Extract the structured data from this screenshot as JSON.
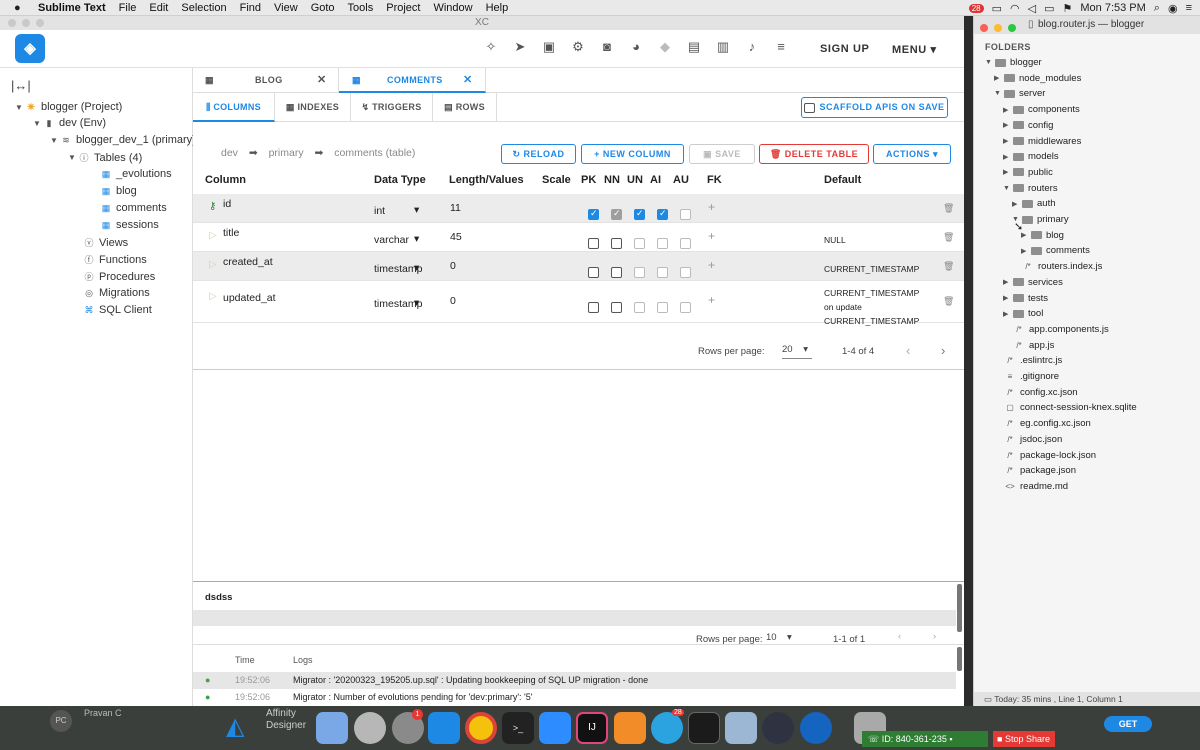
{
  "menubar": {
    "app": "Sublime Text",
    "items": [
      "File",
      "Edit",
      "Selection",
      "Find",
      "View",
      "Goto",
      "Tools",
      "Project",
      "Window",
      "Help"
    ],
    "badge": "28",
    "clock": "Mon 7:53 PM"
  },
  "xc": {
    "window_title": "XC",
    "signup": "SIGN UP",
    "menu": "MENU"
  },
  "sidebar": {
    "project": "blogger (Project)",
    "env": "dev (Env)",
    "db": "blogger_dev_1 (primary)",
    "tables_label": "Tables (4)",
    "tables": [
      "_evolutions",
      "blog",
      "comments",
      "sessions"
    ],
    "items": [
      "Views",
      "Functions",
      "Procedures",
      "Migrations",
      "SQL Client"
    ]
  },
  "tabs": [
    {
      "label": "BLOG"
    },
    {
      "label": "COMMENTS"
    }
  ],
  "subtabs": [
    "COLUMNS",
    "INDEXES",
    "TRIGGERS",
    "ROWS"
  ],
  "scaffold": "SCAFFOLD APIS ON SAVE",
  "breadcrumb": {
    "a": "dev",
    "b": "primary",
    "c": "comments (table)"
  },
  "actions": {
    "reload": "RELOAD",
    "new_column": "NEW COLUMN",
    "save": "SAVE",
    "delete": "DELETE TABLE",
    "actions": "ACTIONS"
  },
  "headers": [
    "Column",
    "Data Type",
    "Length/Values",
    "Scale",
    "PK",
    "NN",
    "UN",
    "AI",
    "AU",
    "FK",
    "Default"
  ],
  "rows": [
    {
      "name": "id",
      "type": "int",
      "len": "11",
      "default": "",
      "pk": "on",
      "nn": "ondis",
      "un": "on",
      "ai": "on",
      "au": "dis"
    },
    {
      "name": "title",
      "type": "varchar",
      "len": "45",
      "default": "NULL",
      "pk": "off",
      "nn": "off",
      "un": "dis",
      "ai": "dis",
      "au": "dis"
    },
    {
      "name": "created_at",
      "type": "timestamp",
      "len": "0",
      "default": "CURRENT_TIMESTAMP",
      "pk": "off",
      "nn": "off",
      "un": "dis",
      "ai": "dis",
      "au": "dis"
    },
    {
      "name": "updated_at",
      "type": "timestamp",
      "len": "0",
      "default": "CURRENT_TIMESTAMP on update CURRENT_TIMESTAMP",
      "pk": "off",
      "nn": "off",
      "un": "dis",
      "ai": "dis",
      "au": "dis"
    }
  ],
  "pagination": {
    "label": "Rows per page:",
    "value": "20",
    "range": "1-4 of 4"
  },
  "bottom": {
    "title": "dsdss",
    "rows_label": "Rows per page:",
    "rows_value": "10",
    "range": "1-1 of 1",
    "time_header": "Time",
    "logs_header": "Logs",
    "logs": [
      {
        "time": "19:52:06",
        "msg": "Migrator : '20200323_195205.up.sql' : Updating bookkeeping of SQL UP migration - done"
      },
      {
        "time": "19:52:06",
        "msg": "Migrator : Number of evolutions pending for 'dev:primary': '5'"
      }
    ]
  },
  "sublime": {
    "title": "blog.router.js — blogger",
    "folders_label": "FOLDERS",
    "status": "Today: 35 mins , Line 1, Column 1",
    "tree": [
      {
        "label": "blogger",
        "depth": 0,
        "kind": "folder",
        "open": true
      },
      {
        "label": "node_modules",
        "depth": 1,
        "kind": "folder"
      },
      {
        "label": "server",
        "depth": 1,
        "kind": "folder",
        "open": true
      },
      {
        "label": "components",
        "depth": 2,
        "kind": "folder"
      },
      {
        "label": "config",
        "depth": 2,
        "kind": "folder"
      },
      {
        "label": "middlewares",
        "depth": 2,
        "kind": "folder"
      },
      {
        "label": "models",
        "depth": 2,
        "kind": "folder"
      },
      {
        "label": "public",
        "depth": 2,
        "kind": "folder"
      },
      {
        "label": "routers",
        "depth": 2,
        "kind": "folder",
        "open": true
      },
      {
        "label": "auth",
        "depth": 3,
        "kind": "folder"
      },
      {
        "label": "primary",
        "depth": 3,
        "kind": "folder",
        "open": true
      },
      {
        "label": "blog",
        "depth": 4,
        "kind": "folder"
      },
      {
        "label": "comments",
        "depth": 4,
        "kind": "folder"
      },
      {
        "label": "routers.index.js",
        "depth": 3,
        "kind": "file",
        "icon": "/*"
      },
      {
        "label": "services",
        "depth": 2,
        "kind": "folder"
      },
      {
        "label": "tests",
        "depth": 2,
        "kind": "folder"
      },
      {
        "label": "tool",
        "depth": 2,
        "kind": "folder"
      },
      {
        "label": "app.components.js",
        "depth": 2,
        "kind": "file",
        "icon": "/*"
      },
      {
        "label": "app.js",
        "depth": 2,
        "kind": "file",
        "icon": "/*"
      },
      {
        "label": ".eslintrc.js",
        "depth": 1,
        "kind": "file",
        "icon": "/*"
      },
      {
        "label": ".gitignore",
        "depth": 1,
        "kind": "file",
        "icon": "≡"
      },
      {
        "label": "config.xc.json",
        "depth": 1,
        "kind": "file",
        "icon": "/*"
      },
      {
        "label": "connect-session-knex.sqlite",
        "depth": 1,
        "kind": "file",
        "icon": "▢"
      },
      {
        "label": "eg.config.xc.json",
        "depth": 1,
        "kind": "file",
        "icon": "/*"
      },
      {
        "label": "jsdoc.json",
        "depth": 1,
        "kind": "file",
        "icon": "/*"
      },
      {
        "label": "package-lock.json",
        "depth": 1,
        "kind": "file",
        "icon": "/*"
      },
      {
        "label": "package.json",
        "depth": 1,
        "kind": "file",
        "icon": "/*"
      },
      {
        "label": "readme.md",
        "depth": 1,
        "kind": "file",
        "icon": "<>"
      }
    ]
  },
  "dock": {
    "left_name": "Pravan C",
    "affinity": "Affinity Designer",
    "id_label": "ID: 840-361-235",
    "stop_share": "Stop Share",
    "get": "GET",
    "badge1": "1",
    "badge2": "28"
  }
}
